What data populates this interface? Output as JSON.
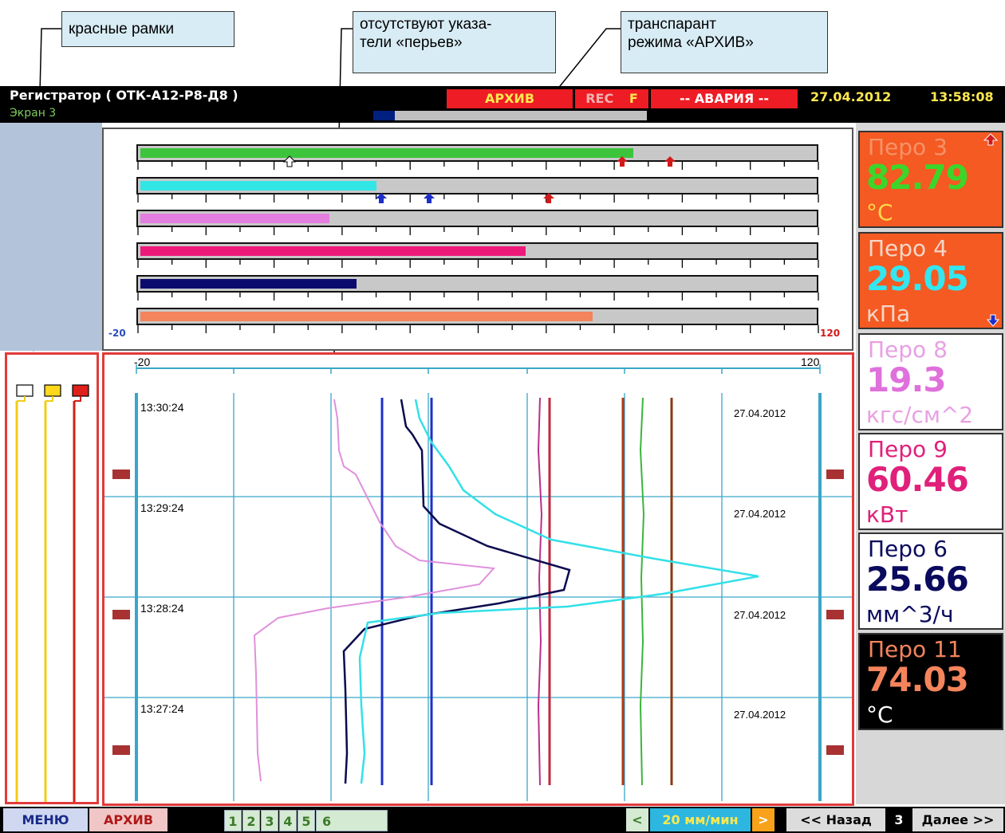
{
  "callouts": {
    "red_frames": "красные рамки",
    "no_pointers": "отсутствуют указа-\nтели «перьев»",
    "archive_banner": "транспарант\nрежима «АРХИВ»"
  },
  "header": {
    "title": "Регистратор ( ОТК-А12-Р8-Д8 )",
    "screen": "Экран 3",
    "archive_badge": "АРХИВ",
    "rec_label": "REC",
    "rec_flag": "F",
    "alarm": "-- АВАРИЯ --",
    "date": "27.04.2012",
    "time": "13:58:08",
    "progress_fraction": 0.08
  },
  "bars": {
    "min_label": "-20",
    "max_label": "120",
    "rows": [
      {
        "color": "#3cc43c",
        "fill": 0.73
      },
      {
        "color": "#33e6e6",
        "fill": 0.35
      },
      {
        "color": "#e47ee0",
        "fill": 0.28
      },
      {
        "color": "#ee1a7a",
        "fill": 0.57
      },
      {
        "color": "#0a0a6e",
        "fill": 0.32
      },
      {
        "color": "#f4845c",
        "fill": 0.67
      }
    ]
  },
  "trend": {
    "scale_min": "-20",
    "scale_max": "120",
    "times": [
      "13:30:24",
      "13:29:24",
      "13:28:24",
      "13:27:24"
    ],
    "dates": [
      "27.04.2012",
      "27.04.2012",
      "27.04.2012",
      "27.04.2012"
    ]
  },
  "pens": [
    {
      "name": "Перо 3",
      "value": "82.79",
      "unit": "°C",
      "bg": "#f45a22",
      "name_color": "#f79268",
      "value_color": "#3cd62a",
      "unit_color": "#ffd84a"
    },
    {
      "name": "Перо 4",
      "value": "29.05",
      "unit": "кПа",
      "bg": "#f45a22",
      "name_color": "#f5d6c8",
      "value_color": "#33e6f0",
      "unit_color": "#f5d6c8"
    },
    {
      "name": "Перо 8",
      "value": "19.3",
      "unit": "кгс/см^2",
      "bg": "#ffffff",
      "name_color": "#e8a0e4",
      "value_color": "#e070dc",
      "unit_color": "#e8a0e4"
    },
    {
      "name": "Перо 9",
      "value": "60.46",
      "unit": "кВт",
      "bg": "#ffffff",
      "name_color": "#e0207a",
      "value_color": "#e0207a",
      "unit_color": "#e0207a"
    },
    {
      "name": "Перо 6",
      "value": "25.66",
      "unit": "мм^3/ч",
      "bg": "#ffffff",
      "name_color": "#0a0a5e",
      "value_color": "#0a0a5e",
      "unit_color": "#0a0a5e"
    },
    {
      "name": "Перо 11",
      "value": "74.03",
      "unit": "°C",
      "bg": "#000000",
      "name_color": "#f4845c",
      "value_color": "#f4845c",
      "unit_color": "#ffffff"
    }
  ],
  "bottom": {
    "menu": "МЕНЮ",
    "archive": "АРХИВ",
    "screens": [
      "1",
      "2",
      "3",
      "4",
      "5",
      "6"
    ],
    "speed_dec": "<",
    "speed": "20 мм/мин",
    "speed_inc": ">",
    "back": "<< Назад",
    "page": "3",
    "next": "Далее >>"
  }
}
